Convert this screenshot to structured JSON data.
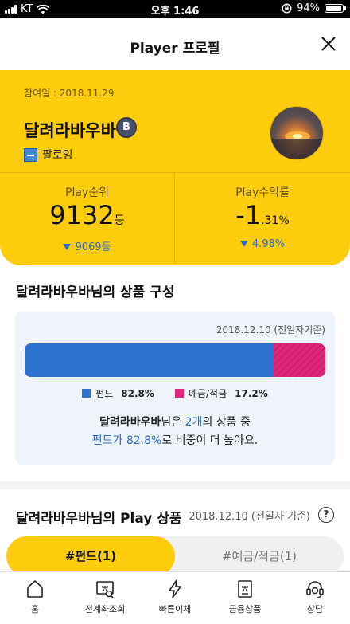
{
  "status_bar": {
    "carrier": "KT",
    "time": "오후 1:46",
    "battery": "94%"
  },
  "header": {
    "title": "Player 프로필"
  },
  "profile": {
    "joined": "참여일 : 2018.11.29",
    "nickname": "달려라바우바",
    "grade": "B",
    "follow_label": "팔로잉",
    "rank": {
      "label": "Play순위",
      "value": "9132",
      "unit": "등",
      "change": "9069등"
    },
    "return": {
      "label": "Play수익률",
      "value": "-1",
      "unit": ".31%",
      "change": "4.98%"
    }
  },
  "composition": {
    "title": "달려라바우바님의 상품 구성",
    "date": "2018.12.10 (전일자기준)",
    "items": [
      {
        "name": "펀드",
        "percent": "82.8%",
        "color": "#2e72cf"
      },
      {
        "name": "예금/적금",
        "percent": "17.2%",
        "color": "#e0267a"
      }
    ],
    "summary": {
      "name": "달려라바우바",
      "t1": "님은 ",
      "count": "2개",
      "t2": "의 상품 중",
      "highlight": "펀드가 82.8%",
      "t3": "로 비중이 더 높아요."
    }
  },
  "chart_data": {
    "type": "bar",
    "categories": [
      "펀드",
      "예금/적금"
    ],
    "values": [
      82.8,
      17.2
    ]
  },
  "play_products": {
    "title": "달려라바우바님의 Play 상품",
    "date": "2018.12.10 (전일자 기준)",
    "help": "?",
    "tabs": [
      {
        "label": "#펀드(1)"
      },
      {
        "label": "#예금/적금(1)"
      }
    ]
  },
  "bottom_nav": [
    {
      "label": "홈",
      "icon": "home-icon"
    },
    {
      "label": "전계좌조회",
      "icon": "account-search-icon"
    },
    {
      "label": "빠른이체",
      "icon": "lightning-icon"
    },
    {
      "label": "금융상품",
      "icon": "product-icon"
    },
    {
      "label": "상담",
      "icon": "headset-icon"
    }
  ]
}
